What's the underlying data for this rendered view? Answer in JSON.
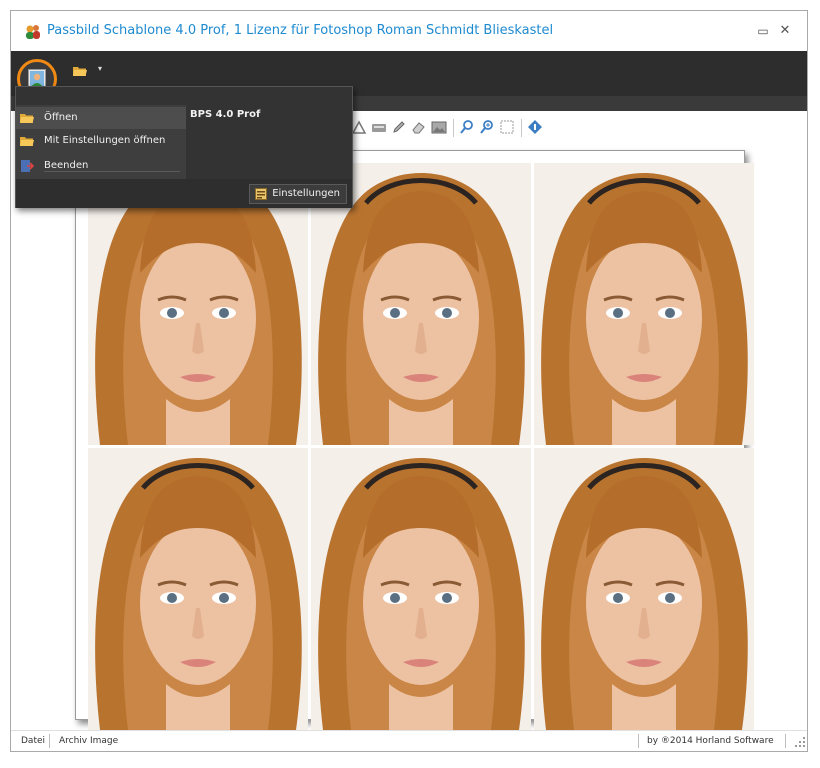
{
  "window": {
    "title": "Passbild Schablone 4.0 Prof, 1 Lizenz für Fotoshop Roman Schmidt Blieskastel",
    "minimize_glyph": "▭",
    "close_glyph": "✕"
  },
  "icons": {
    "app": "people-icon",
    "app_button": "portrait-icon",
    "quick_access": "folder-icon",
    "quick_access_caret": "▾"
  },
  "app_menu": {
    "heading": "BPS 4.0 Prof",
    "items": [
      {
        "label": "Öffnen",
        "icon": "folder-open-icon"
      },
      {
        "label": "Mit Einstellungen öffnen",
        "icon": "folder-open-icon"
      },
      {
        "label": "Beenden",
        "icon": "exit-icon"
      }
    ],
    "settings_button": "Einstellungen"
  },
  "statusbar": {
    "left": [
      "Datei",
      "Archiv Image"
    ],
    "right": "by ®2014 Horland Software"
  },
  "colors": {
    "title": "#1e8ad0",
    "ribbon": "#2d2d2d",
    "app_button_ring": "#f08a14",
    "menu_bg": "#333333"
  }
}
